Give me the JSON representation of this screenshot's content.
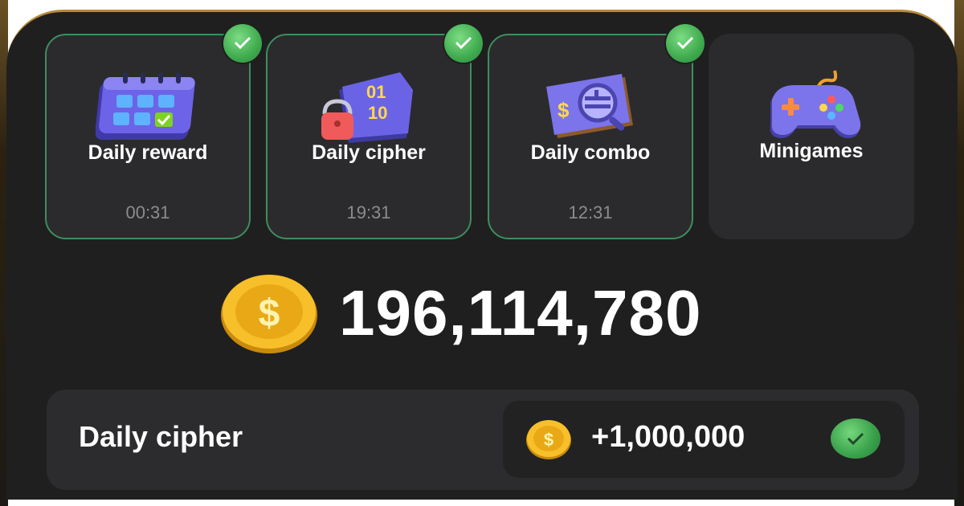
{
  "cards": [
    {
      "label": "Daily reward",
      "timer": "00:31",
      "completed": true,
      "icon": "calendar-icon"
    },
    {
      "label": "Daily cipher",
      "timer": "19:31",
      "completed": true,
      "icon": "cipher-lock-icon"
    },
    {
      "label": "Daily combo",
      "timer": "12:31",
      "completed": true,
      "icon": "combo-card-icon"
    },
    {
      "label": "Minigames",
      "timer": "",
      "completed": false,
      "icon": "gamepad-icon"
    }
  ],
  "balance": {
    "amount": "196,114,780",
    "icon": "coin-icon"
  },
  "cipher_reward": {
    "title": "Daily cipher",
    "amount": "+1,000,000",
    "icon": "coin-icon",
    "status_icon": "check-icon"
  },
  "colors": {
    "background": "#1f1f20",
    "card": "#2b2b2d",
    "completed_border": "#3f8d5f",
    "check_green": "#3faa4e",
    "coin_gold": "#f2b516"
  }
}
